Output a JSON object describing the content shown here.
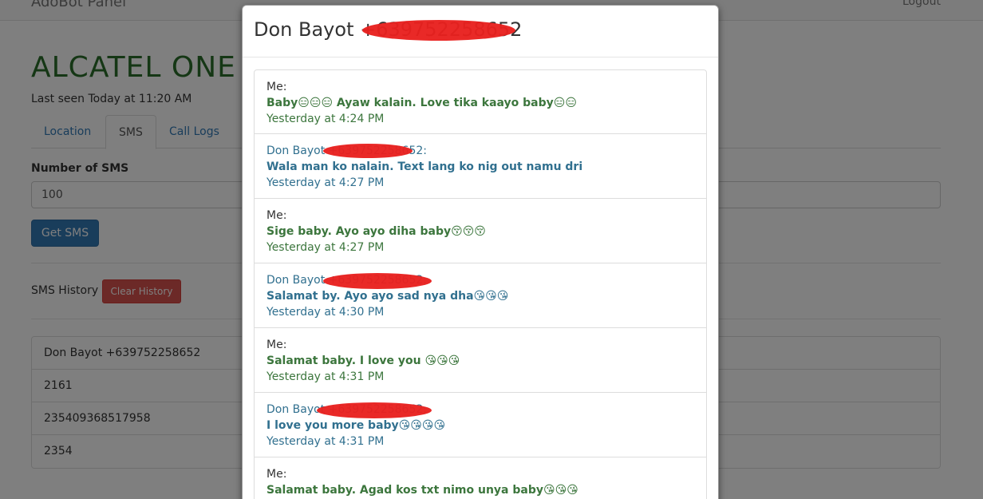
{
  "navbar": {
    "brand": "AdoBot Panel",
    "logout": "Logout"
  },
  "device": {
    "title": "ALCATEL ONE T",
    "last_seen": "Last seen Today at 11:20 AM"
  },
  "tabs": [
    {
      "label": "Location"
    },
    {
      "label": "SMS"
    },
    {
      "label": "Call Logs"
    }
  ],
  "form": {
    "number_label": "Number of SMS",
    "number_value": "100",
    "get_button": "Get SMS"
  },
  "history": {
    "label": "SMS History",
    "clear_button": "Clear History",
    "items": [
      "Don Bayot +639752258652",
      "2161",
      "235409368517958",
      "2354"
    ]
  },
  "modal": {
    "title": "Don Bayot +639752258652",
    "messages": [
      {
        "from": "Me:",
        "body": "Baby😑😑😑 Ayaw kalain. Love tika kaayo baby😑😑",
        "time": "Yesterday at 4:24 PM"
      },
      {
        "from": "Don Bayot +639752258652:",
        "body": "Wala man ko nalain. Text lang ko nig out namu dri",
        "time": "Yesterday at 4:27 PM"
      },
      {
        "from": "Me:",
        "body": "Sige baby. Ayo ayo diha baby😚😚😚",
        "time": "Yesterday at 4:27 PM"
      },
      {
        "from": "Don Bayot +639752258652:",
        "body": "Salamat by. Ayo ayo sad nya dha😘😘😘",
        "time": "Yesterday at 4:30 PM"
      },
      {
        "from": "Me:",
        "body": "Salamat baby. I love you 😘😘😘",
        "time": "Yesterday at 4:31 PM"
      },
      {
        "from": "Don Bayot +639752258652:",
        "body": "I love you more baby😘😘😘😘",
        "time": "Yesterday at 4:31 PM"
      },
      {
        "from": "Me:",
        "body": "Salamat baby. Agad kos txt nimo unya baby😘😘😘",
        "time": ""
      }
    ]
  },
  "colors": {
    "me": "#3c763d",
    "them": "#31708f",
    "redaction": "#e8201e",
    "title_green": "#2b6e2b"
  }
}
